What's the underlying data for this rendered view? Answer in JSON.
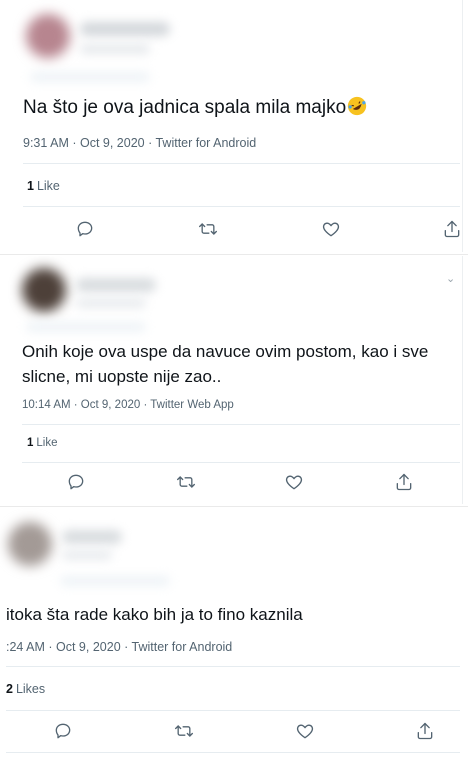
{
  "tweets": [
    {
      "text": "Na što je ova jadnica spala mila majko",
      "emoji": "rolling-on-the-floor-laughing",
      "meta": "9:31 AM · Oct 9, 2020 · Twitter for Android",
      "likes_count": "1",
      "likes_label": "Like"
    },
    {
      "text_line1": "Onih koje ova uspe da navuce ovim postom, kao i sve",
      "text_line2": "slicne, mi uopste nije zao..",
      "meta": "10:14 AM · Oct 9, 2020 · Twitter Web App",
      "likes_count": "1",
      "likes_label": "Like"
    },
    {
      "text": "itoka šta rade kako bih ja to fino kaznila",
      "meta": ":24 AM · Oct 9, 2020 · Twitter for Android",
      "likes_count": "2",
      "likes_label": "Likes"
    }
  ],
  "icons": [
    "reply-icon",
    "retweet-icon",
    "like-icon",
    "share-icon",
    "chevron-down-icon"
  ],
  "colors": {
    "text": "#0f1419",
    "secondary": "#536471",
    "divider": "#e6ecf0"
  }
}
